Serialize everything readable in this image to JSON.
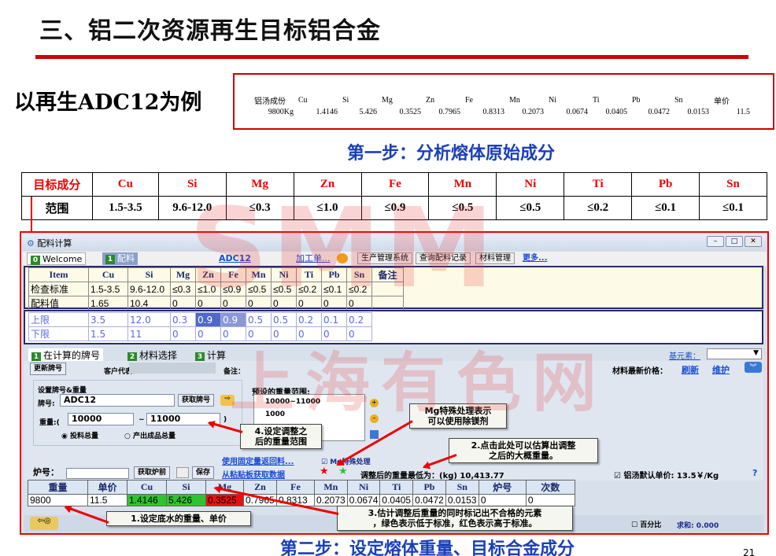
{
  "slide": {
    "title": "三、铝二次资源再生目标铝合金",
    "subtitle": "以再生ADC12为例",
    "step1": "第一步：分析熔体原始成分",
    "step2": "第二步：设定熔体重量、目标合金成分",
    "page_number": "21",
    "watermark_top": "SMM",
    "watermark_bottom": "上海有色网"
  },
  "melt": {
    "headers": [
      "铝汤成份",
      "Cu",
      "Si",
      "Mg",
      "Zn",
      "Fe",
      "Mn",
      "Ni",
      "Ti",
      "Pb",
      "Sn",
      "单价"
    ],
    "values": [
      "9800Kg",
      "1.4146",
      "5.426",
      "0.3525",
      "0.7965",
      "0.8313",
      "0.2073",
      "0.0674",
      "0.0405",
      "0.0472",
      "0.0153",
      "11.5"
    ]
  },
  "target": {
    "headers": [
      "目标成分",
      "Cu",
      "Si",
      "Mg",
      "Zn",
      "Fe",
      "Mn",
      "Ni",
      "Ti",
      "Pb",
      "Sn"
    ],
    "ranges": [
      "范围",
      "1.5-3.5",
      "9.6-12.0",
      "≤0.3",
      "≤1.0",
      "≤0.9",
      "≤0.5",
      "≤0.5",
      "≤0.2",
      "≤0.1",
      "≤0.1"
    ]
  },
  "app": {
    "window_title": "配料计算",
    "tabs": [
      {
        "num": "0",
        "label": "Welcome"
      },
      {
        "num": "1",
        "label": "配料"
      }
    ],
    "alloy_name": "ADC12",
    "add_link": "加工单...",
    "buttons": [
      "生产管理系统",
      "查询配料记录",
      "材料管理"
    ],
    "more": "更多...",
    "std_table": {
      "headers": [
        "Item",
        "Cu",
        "Si",
        "Mg",
        "Zn",
        "Fe",
        "Mn",
        "Ni",
        "Ti",
        "Pb",
        "Sn",
        "备注"
      ],
      "rows": [
        [
          "检查标准",
          "1.5-3.5",
          "9.6-12.0",
          "≤0.3",
          "≤1.0",
          "≤0.9",
          "≤0.5",
          "≤0.5",
          "≤0.2",
          "≤0.1",
          "≤0.2",
          ""
        ],
        [
          "配料值",
          "1.65",
          "10.4",
          "0",
          "0",
          "0",
          "0",
          "0",
          "0",
          "0",
          "0",
          ""
        ]
      ]
    },
    "limit_table": {
      "rows": [
        [
          "上限",
          "3.5",
          "12.0",
          "0.3",
          "0.9",
          "0.9",
          "0.5",
          "0.5",
          "0.2",
          "0.1",
          "0.2"
        ],
        [
          "下限",
          "1.5",
          "11",
          "0",
          "0",
          "0",
          "0",
          "0",
          "0",
          "0",
          "0"
        ]
      ]
    },
    "subtabs": [
      {
        "num": "1",
        "label": "在计算的牌号"
      },
      {
        "num": "2",
        "label": "材料选择"
      },
      {
        "num": "3",
        "label": "计算"
      }
    ],
    "base_element_label": "基元素：",
    "form": {
      "new_grade_btn": "更新牌号",
      "customer_label": "客户代表：",
      "note_label": "备注：",
      "price_label": "材料最新价格：",
      "refresh": "刷新",
      "maintain": "维护",
      "set_grade_label": "设置牌号&重量",
      "grade_label": "牌号:",
      "grade_value": "ADC12",
      "get_grade_btn": "获取牌号",
      "preset_label": "预设的重量范围:",
      "preset_options": [
        "10000~11000",
        "1000"
      ],
      "weight_label": "重量:(",
      "weight_from": "10000",
      "weight_sep": "~",
      "weight_to": "11000",
      "weight_close": ")",
      "radio_input": "投料总量",
      "radio_output": "产出成品总量",
      "use_fixed": "使用固定量返回料...",
      "mg_special": "Mg特殊处理",
      "paste": "从粘贴板获取数据",
      "furnace_label": "炉号：",
      "get_furnace_btn": "获取炉前",
      "save_btn": "保存",
      "min_weight": "调整后的重量最低为：(kg) 10,413.77",
      "default_price": "铝汤默认单价: 13.5￥/Kg",
      "help": "?"
    },
    "alloy_table": {
      "headers": [
        "重量",
        "单价",
        "Cu",
        "Si",
        "Mg",
        "Zn",
        "Fe",
        "Mn",
        "Ni",
        "Ti",
        "Pb",
        "Sn",
        "炉号",
        "次数"
      ],
      "row": [
        "9800",
        "11.5",
        "1.4146",
        "5.426",
        "0.3525",
        "0.7965",
        "0.8313",
        "0.2073",
        "0.0674",
        "0.0405",
        "0.0472",
        "0.0153",
        "0",
        "0"
      ]
    },
    "bottom": {
      "percent": "百分比",
      "sum": "求和: 0.000"
    }
  },
  "callouts": {
    "c1": "1.设定底水的重量、单价",
    "c2": "2.点击此处可以估算出调整\n之后的大概重量。",
    "c3": "3.估计调整后重量的同时标记出不合格的元素\n，绿色表示低于标准，红色表示高于标准。",
    "c4": "4.设定调整之\n后的重量范围",
    "c5": "Mg特殊处理表示\n可以使用除镁剂"
  }
}
